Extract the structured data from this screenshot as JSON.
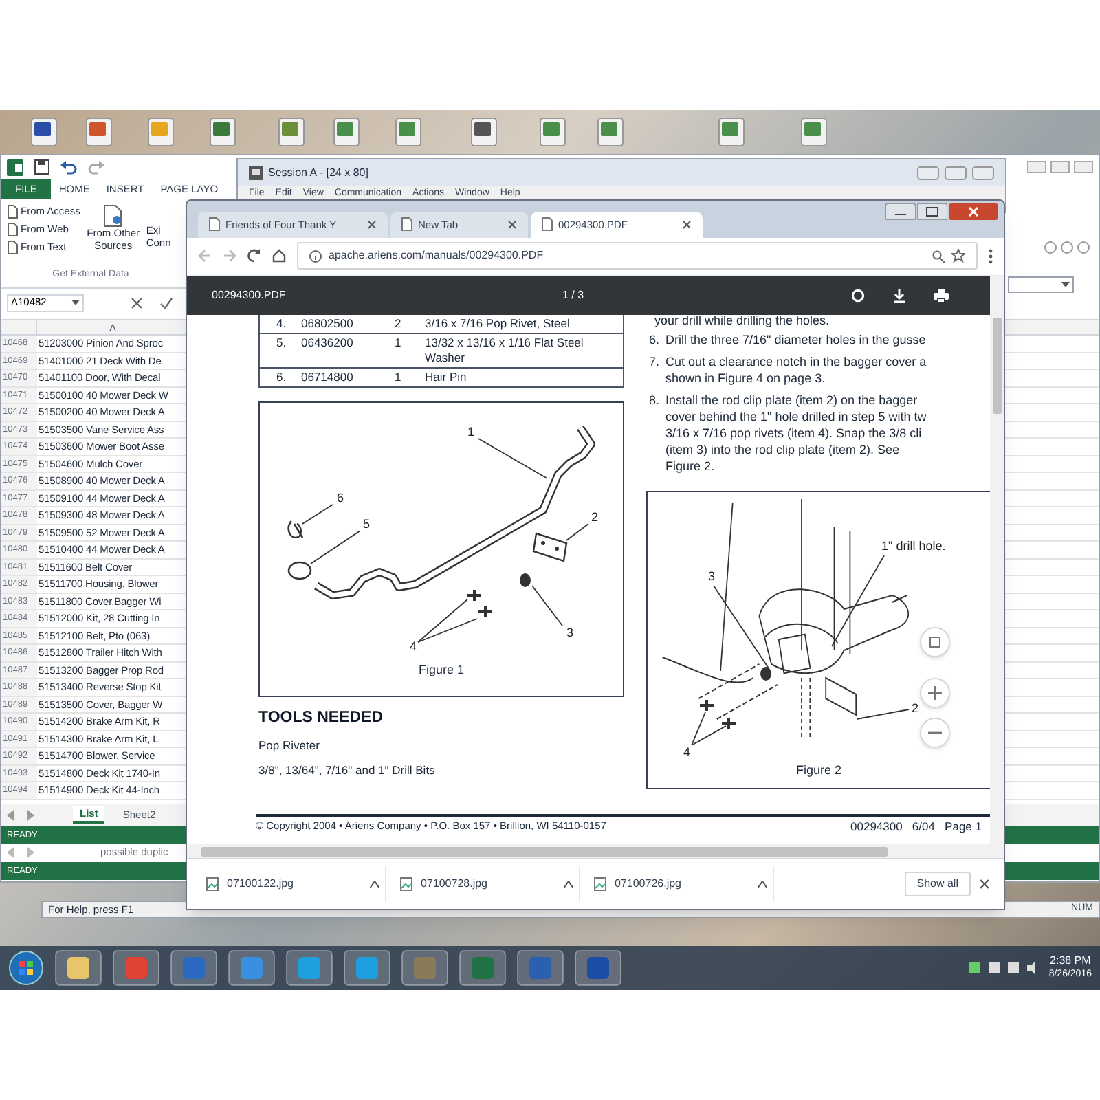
{
  "excel": {
    "ribbon_tabs": [
      {
        "label": "FILE",
        "kind": "file"
      },
      {
        "label": "HOME",
        "kind": "tab"
      },
      {
        "label": "INSERT",
        "kind": "tab"
      },
      {
        "label": "PAGE LAYO",
        "kind": "tab"
      }
    ],
    "data_sources": [
      "From Access",
      "From Web",
      "From Text"
    ],
    "other_sources": "From Other Sources",
    "partial_command": [
      "Exi",
      "Conn"
    ],
    "group_label": "Get External Data",
    "name_box": "A10482",
    "column_header": "A",
    "rows": [
      {
        "row": "10468",
        "cell": "51203000 Pinion And Sproc"
      },
      {
        "row": "10469",
        "cell": "51401000 21 Deck With De"
      },
      {
        "row": "10470",
        "cell": "51401100 Door, With Decal"
      },
      {
        "row": "10471",
        "cell": "51500100 40 Mower Deck W"
      },
      {
        "row": "10472",
        "cell": "51500200 40 Mower Deck A"
      },
      {
        "row": "10473",
        "cell": "51503500 Vane Service Ass"
      },
      {
        "row": "10474",
        "cell": "51503600 Mower Boot Asse"
      },
      {
        "row": "10475",
        "cell": "51504600 Mulch Cover"
      },
      {
        "row": "10476",
        "cell": "51508900 40 Mower Deck A"
      },
      {
        "row": "10477",
        "cell": "51509100 44 Mower Deck A"
      },
      {
        "row": "10478",
        "cell": "51509300 48 Mower Deck A"
      },
      {
        "row": "10479",
        "cell": "51509500 52 Mower Deck A"
      },
      {
        "row": "10480",
        "cell": "51510400 44 Mower Deck A"
      },
      {
        "row": "10481",
        "cell": "51511600 Belt Cover"
      },
      {
        "row": "10482",
        "cell": "51511700 Housing, Blower"
      },
      {
        "row": "10483",
        "cell": "51511800 Cover,Bagger Wi"
      },
      {
        "row": "10484",
        "cell": "51512000 Kit, 28 Cutting In"
      },
      {
        "row": "10485",
        "cell": "51512100 Belt, Pto (063)"
      },
      {
        "row": "10486",
        "cell": "51512800 Trailer Hitch With"
      },
      {
        "row": "10487",
        "cell": "51513200 Bagger Prop Rod"
      },
      {
        "row": "10488",
        "cell": "51513400 Reverse Stop Kit"
      },
      {
        "row": "10489",
        "cell": "51513500 Cover, Bagger W"
      },
      {
        "row": "10490",
        "cell": "51514200 Brake Arm Kit, R"
      },
      {
        "row": "10491",
        "cell": "51514300 Brake Arm Kit, L"
      },
      {
        "row": "10492",
        "cell": "51514700 Blower, Service"
      },
      {
        "row": "10493",
        "cell": "51514800 Deck Kit 1740-In"
      },
      {
        "row": "10494",
        "cell": "51514900 Deck Kit 44-Inch"
      }
    ],
    "sheet_tabs": [
      {
        "label": "List",
        "selected": true
      },
      {
        "label": "Sheet2",
        "selected": false
      }
    ],
    "status": "READY"
  },
  "second_workbook": {
    "cell": "possible duplic",
    "status": "READY"
  },
  "session": {
    "title": "Session A - [24 x 80]",
    "menu": [
      "File",
      "Edit",
      "View",
      "Communication",
      "Actions",
      "Window",
      "Help"
    ],
    "status": "For Help, press F1",
    "indicator": "NUM"
  },
  "browser": {
    "tabs": [
      {
        "label": "Friends of Four Thank Y",
        "selected": false
      },
      {
        "label": "New Tab",
        "selected": false
      },
      {
        "label": "00294300.PDF",
        "selected": true
      }
    ],
    "url": "apache.ariens.com/manuals/00294300.PDF",
    "pdf_toolbar": {
      "title": "00294300.PDF",
      "page": "1 / 3"
    },
    "parts_table": [
      {
        "no": "4.",
        "part": "06802500",
        "qty": "2",
        "desc": "3/16 x 7/16 Pop Rivet, Steel"
      },
      {
        "no": "5.",
        "part": "06436200",
        "qty": "1",
        "desc": "13/32 x 13/16 x 1/16 Flat Steel Washer"
      },
      {
        "no": "6.",
        "part": "06714800",
        "qty": "1",
        "desc": "Hair Pin"
      }
    ],
    "figure_1": {
      "callouts": [
        "1",
        "6",
        "5",
        "2",
        "3",
        "4"
      ],
      "caption": "Figure 1"
    },
    "tools_heading": "TOOLS NEEDED",
    "tools": [
      "Pop Riveter",
      "3/8\", 13/64\", 7/16\" and 1\" Drill Bits"
    ],
    "partial_line": "your drill while drilling the holes.",
    "steps": [
      {
        "number": "6.",
        "lines": [
          "Drill the three 7/16\" diameter holes in the gusse"
        ]
      },
      {
        "number": "7.",
        "lines": [
          "Cut out a clearance notch in the bagger cover a",
          "shown in Figure 4 on page 3."
        ]
      },
      {
        "number": "8.",
        "lines": [
          "Install the rod clip plate (item 2) on the bagger",
          "cover behind the 1\" hole drilled in step 5 with tw",
          "3/16 x 7/16 pop rivets (item 4). Snap the 3/8 cli",
          "(item 3) into the rod clip plate (item 2). See",
          "Figure 2."
        ]
      }
    ],
    "figure_2": {
      "callouts": [
        "1\" drill hole.",
        "3",
        "2",
        "4"
      ],
      "caption": "Figure 2"
    },
    "footer_left": "© Copyright 2004 • Ariens Company • P.O. Box 157 • Brillion, WI 54110-0157",
    "footer_right": "00294300   6/04   Page 1",
    "downloads": [
      "07100122.jpg",
      "07100728.jpg",
      "07100726.jpg"
    ],
    "show_all": "Show all"
  },
  "taskbar": {
    "time": "2:38 PM",
    "date": "8/26/2016"
  }
}
